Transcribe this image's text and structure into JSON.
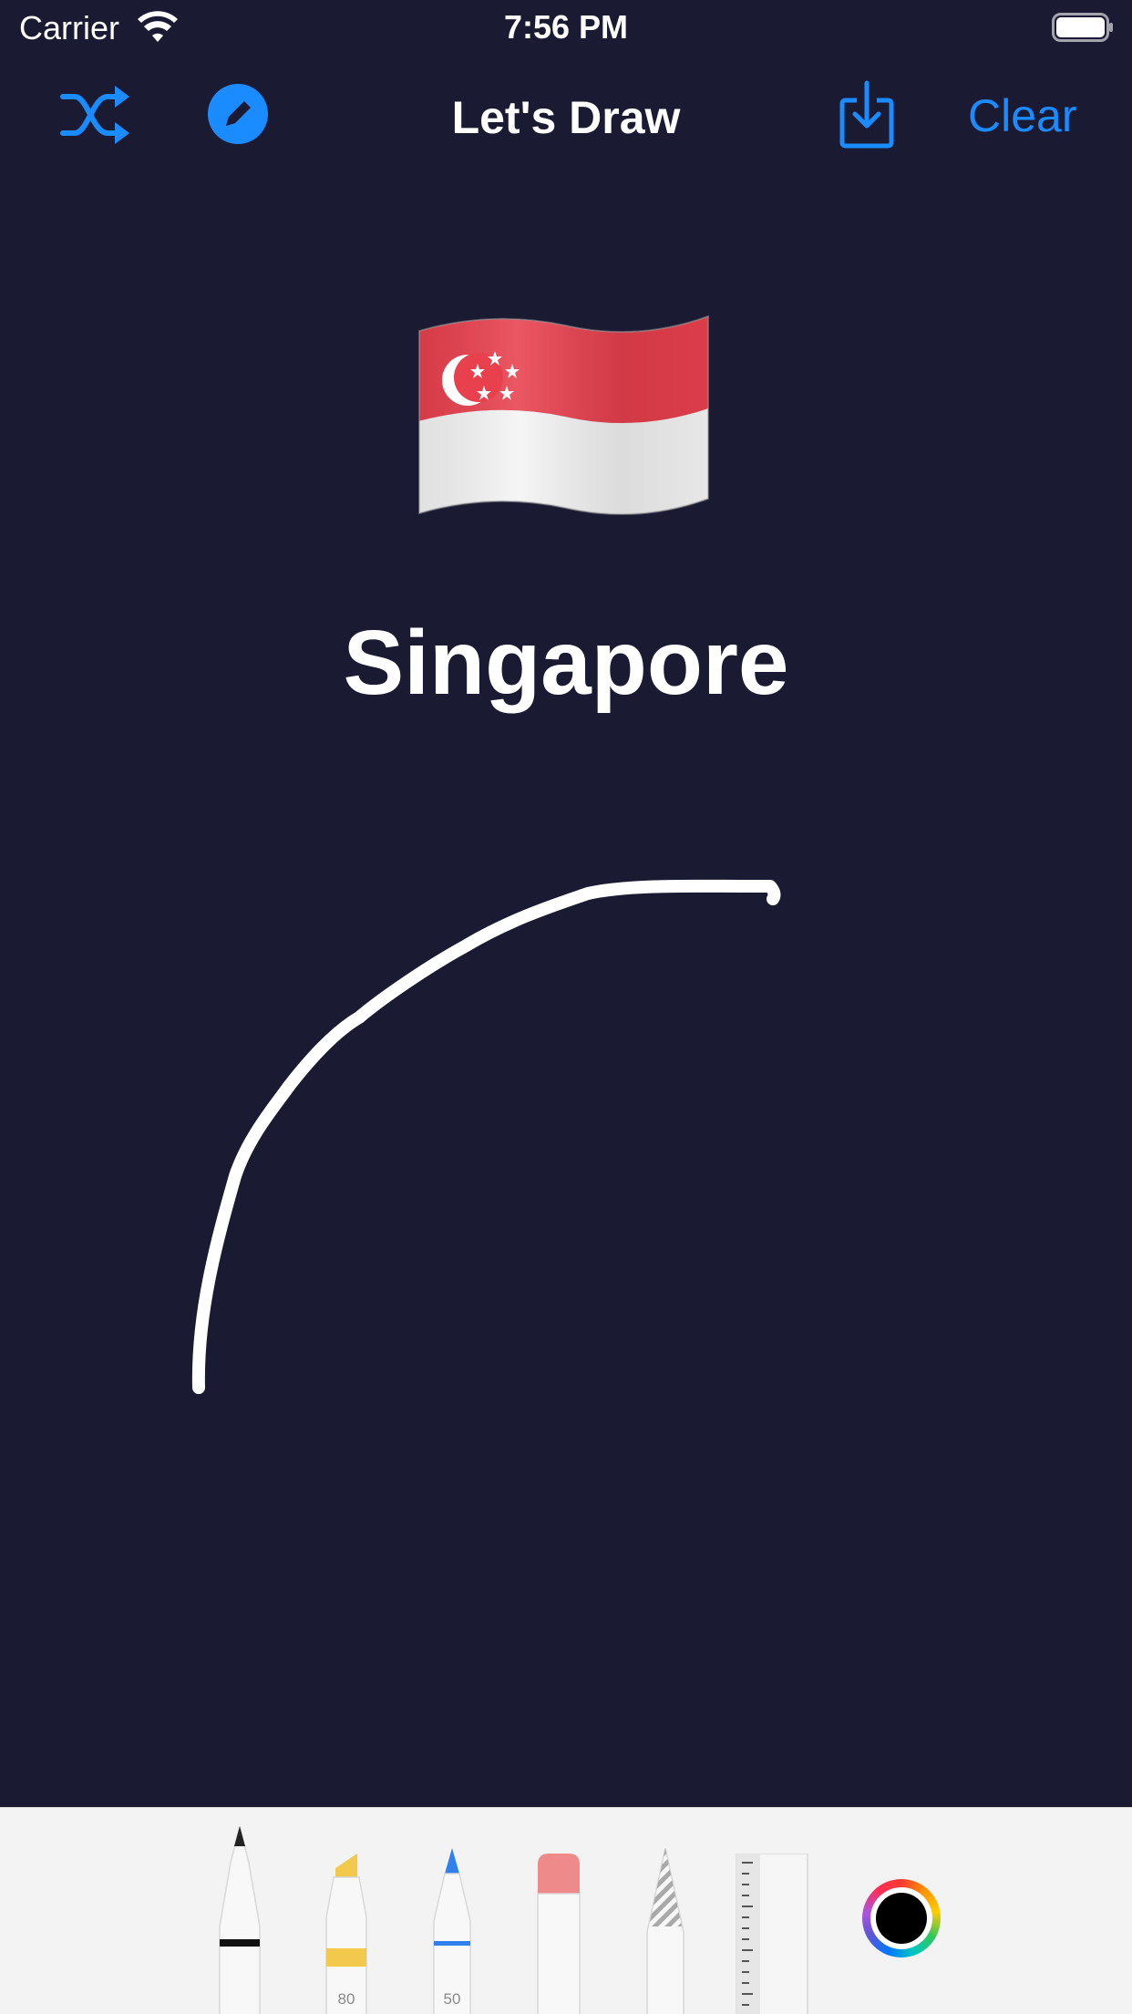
{
  "status_bar": {
    "carrier": "Carrier",
    "time": "7:56 PM"
  },
  "nav": {
    "title": "Let's Draw",
    "clear_label": "Clear"
  },
  "main": {
    "country_name": "Singapore",
    "flag_icon": "singapore-flag"
  },
  "tools": {
    "items": [
      {
        "name": "pen",
        "label": ""
      },
      {
        "name": "marker",
        "label": "80"
      },
      {
        "name": "fine-pen",
        "label": "50"
      },
      {
        "name": "eraser",
        "label": ""
      },
      {
        "name": "lasso",
        "label": ""
      },
      {
        "name": "ruler",
        "label": ""
      }
    ],
    "selected_color": "#000000"
  },
  "colors": {
    "accent": "#1a8cff",
    "background": "#1b1a33",
    "stroke": "#ffffff"
  }
}
